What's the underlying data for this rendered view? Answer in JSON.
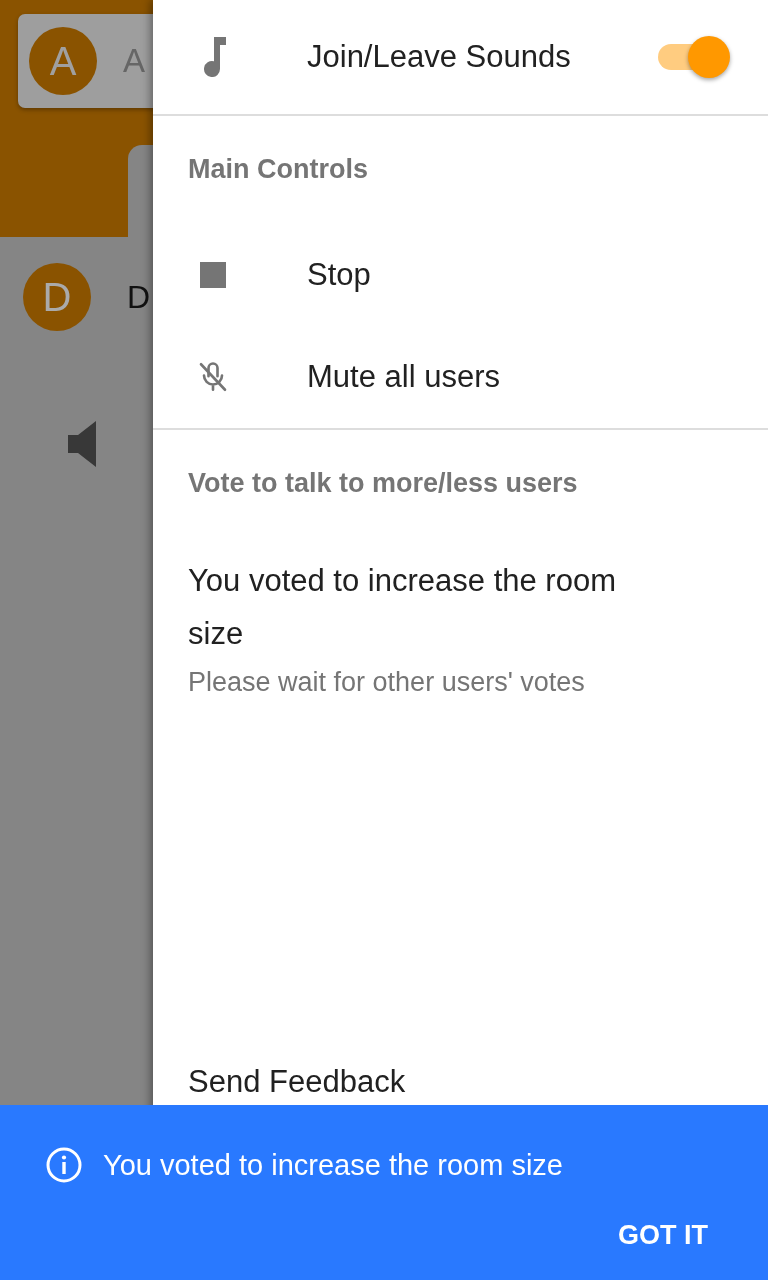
{
  "background": {
    "header_avatar": "A",
    "header_name": "A",
    "list_avatar": "D",
    "list_name": "D"
  },
  "drawer": {
    "top_item": {
      "label": "Join/Leave Sounds",
      "on": true
    },
    "sections": [
      {
        "heading": "Main Controls",
        "items": [
          {
            "label": "Stop",
            "kind": "stop"
          },
          {
            "label": "Mute all users",
            "kind": "mute"
          }
        ]
      },
      {
        "heading": "Vote to talk to more/less users",
        "status": {
          "title": "You voted to increase the room size",
          "subtitle": "Please wait for other users' votes"
        }
      }
    ],
    "footer_item": "Send Feedback"
  },
  "snackbar": {
    "message": "You voted to increase the room size",
    "action": "GOT IT"
  }
}
